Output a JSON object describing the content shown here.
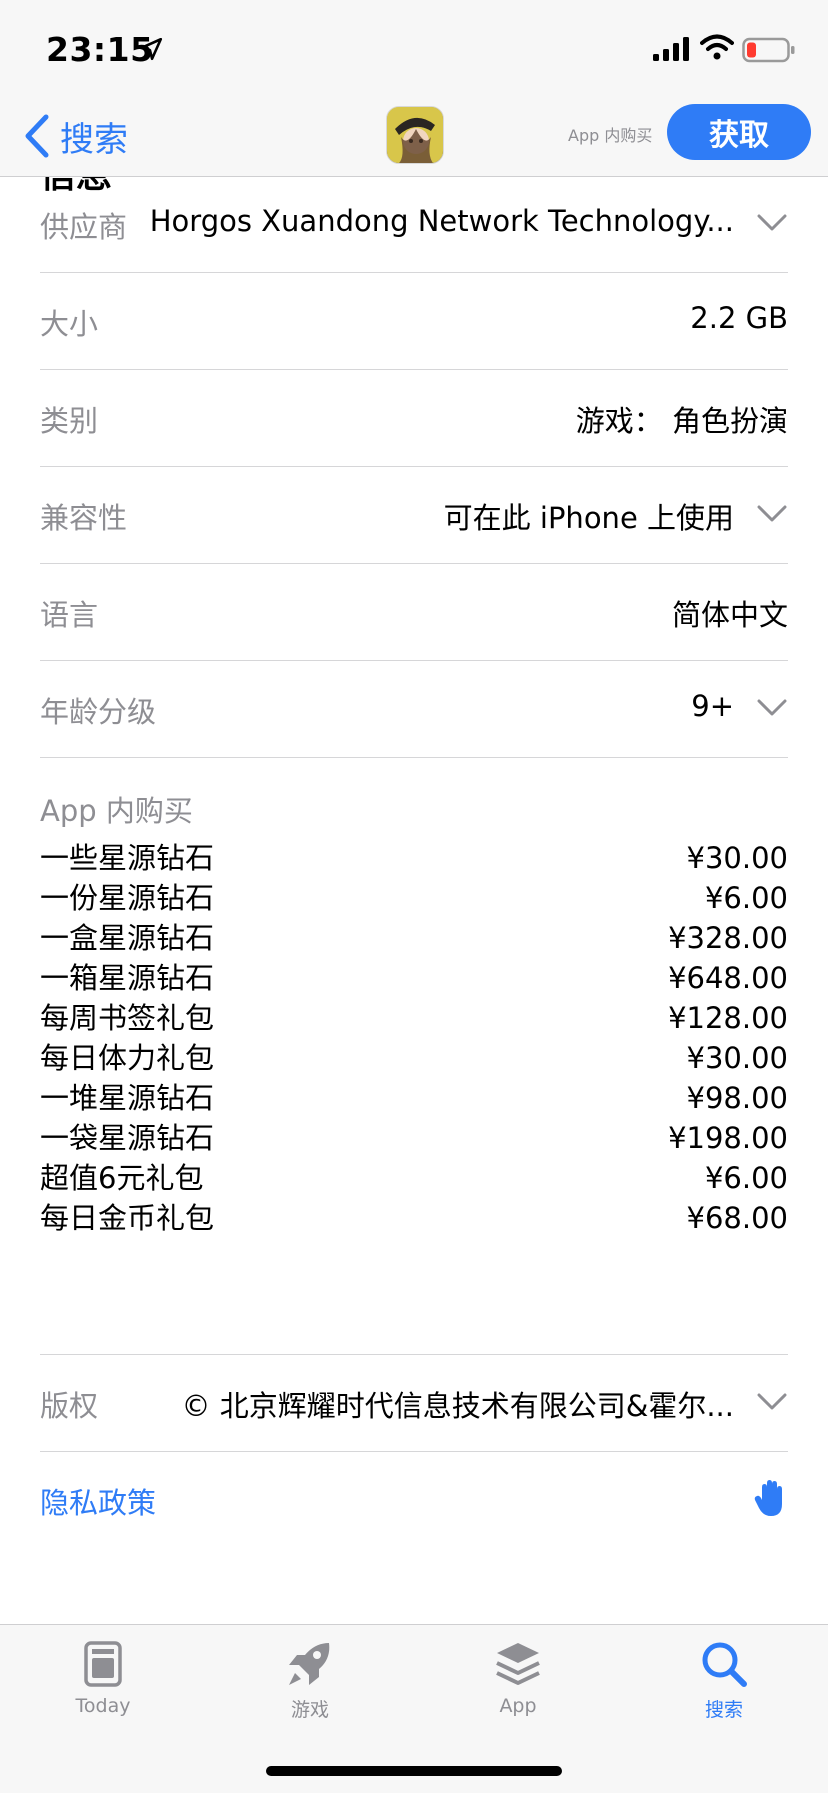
{
  "status": {
    "time": "23:15"
  },
  "nav": {
    "back_label": "搜索",
    "iap_note": "App 内购买",
    "get_label": "获取"
  },
  "partial_heading": "信息",
  "info": {
    "provider": {
      "label": "供应商",
      "value": "Horgos Xuandong Network Technology..."
    },
    "size": {
      "label": "大小",
      "value": "2.2 GB"
    },
    "category": {
      "label": "类别",
      "value": "游戏： 角色扮演"
    },
    "compatibility": {
      "label": "兼容性",
      "value": "可在此 iPhone 上使用"
    },
    "language": {
      "label": "语言",
      "value": "简体中文"
    },
    "age_rating": {
      "label": "年龄分级",
      "value": "9+"
    }
  },
  "in_app_purchases": {
    "title": "App 内购买",
    "items": [
      {
        "name": "一些星源钻石",
        "price": "¥30.00"
      },
      {
        "name": "一份星源钻石",
        "price": "¥6.00"
      },
      {
        "name": "一盒星源钻石",
        "price": "¥328.00"
      },
      {
        "name": "一箱星源钻石",
        "price": "¥648.00"
      },
      {
        "name": "每周书签礼包",
        "price": "¥128.00"
      },
      {
        "name": "每日体力礼包",
        "price": "¥30.00"
      },
      {
        "name": "一堆星源钻石",
        "price": "¥98.00"
      },
      {
        "name": "一袋星源钻石",
        "price": "¥198.00"
      },
      {
        "name": "超值6元礼包",
        "price": "¥6.00"
      },
      {
        "name": "每日金币礼包",
        "price": "¥68.00"
      }
    ]
  },
  "copyright": {
    "label": "版权",
    "value": "© 北京辉耀时代信息技术有限公司&霍尔..."
  },
  "privacy": {
    "label": "隐私政策"
  },
  "tabs": [
    {
      "label": "Today"
    },
    {
      "label": "游戏"
    },
    {
      "label": "App"
    },
    {
      "label": "搜索"
    }
  ],
  "colors": {
    "accent": "#2f7cf6",
    "secondary_text": "#8e8e93",
    "battery_low": "#ff3b30"
  }
}
